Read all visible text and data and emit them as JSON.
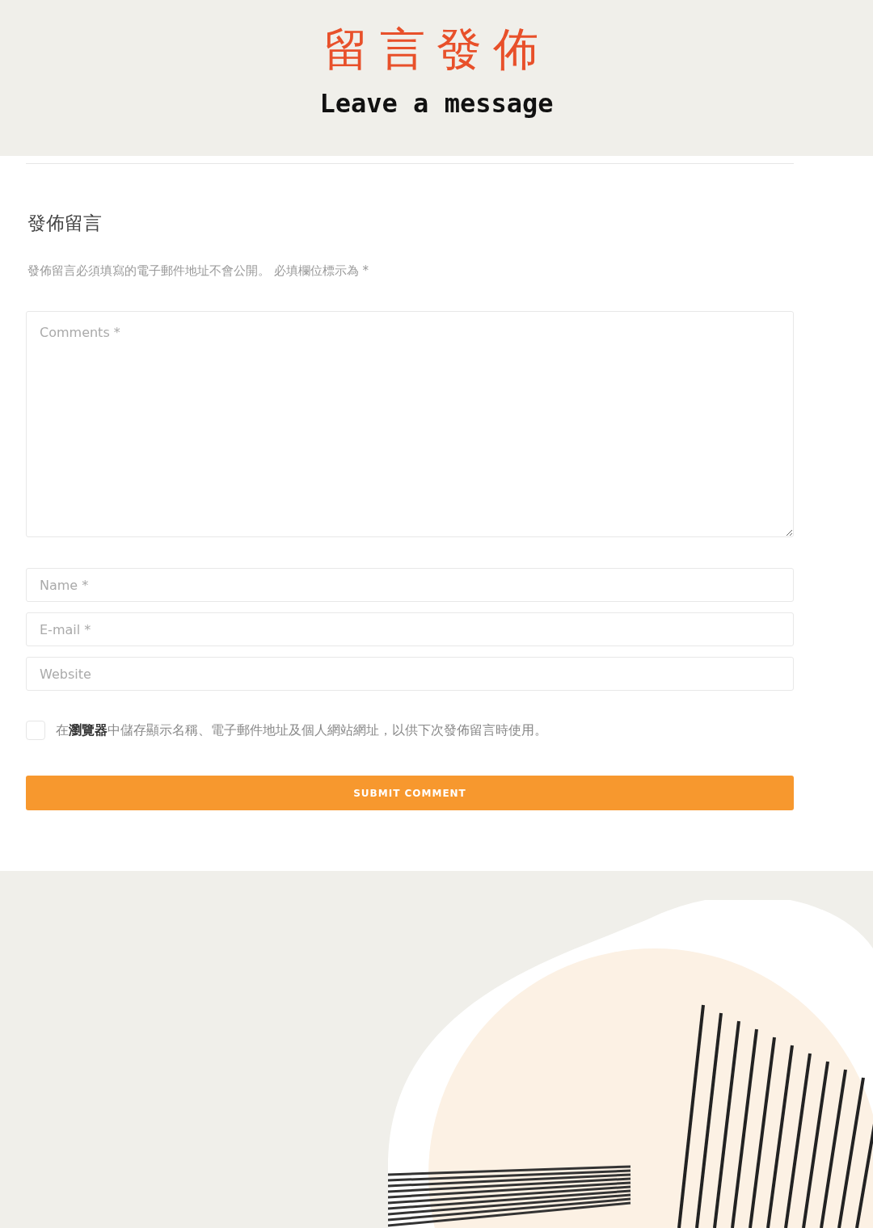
{
  "header": {
    "title_zh": "留言發佈",
    "title_en": "Leave a message"
  },
  "form": {
    "heading": "發佈留言",
    "notice": "發佈留言必須填寫的電子郵件地址不會公開。 必填欄位標示為 *",
    "comment": {
      "placeholder": "Comments *"
    },
    "fields": [
      {
        "placeholder": "Name *"
      },
      {
        "placeholder": "E-mail *"
      },
      {
        "placeholder": "Website"
      }
    ],
    "consent": {
      "checked": false,
      "label": "在**瀏覽器**中儲存顯示名稱、電子郵件地址及個人網站網址，以供下次發佈留言時使用。"
    },
    "submit": "SUBMIT COMMENT"
  }
}
